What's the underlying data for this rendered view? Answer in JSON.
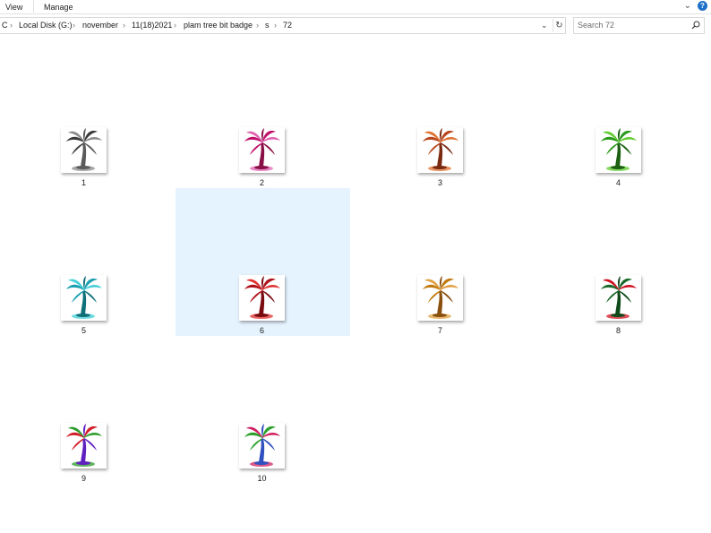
{
  "ribbon": {
    "tabs": [
      "View",
      "Manage"
    ]
  },
  "address": {
    "crumbs": [
      "C",
      "Local Disk (G:)",
      "november",
      "11(18)2021",
      "plam tree bit badge",
      "s",
      "72"
    ]
  },
  "search": {
    "placeholder": "Search 72"
  },
  "files": [
    {
      "name": "1",
      "palette": [
        "#3a3a3a",
        "#8a8a8a",
        "#5a5a5a"
      ]
    },
    {
      "name": "2",
      "palette": [
        "#c0106a",
        "#e060b0",
        "#8a1048"
      ]
    },
    {
      "name": "3",
      "palette": [
        "#b8441a",
        "#e07030",
        "#7a2a10"
      ]
    },
    {
      "name": "4",
      "palette": [
        "#2a9a1a",
        "#60cc30",
        "#1a6010"
      ]
    },
    {
      "name": "5",
      "palette": [
        "#1aa0b0",
        "#40d0d8",
        "#10707a"
      ]
    },
    {
      "name": "6",
      "palette": [
        "#b0101a",
        "#e03030",
        "#7a0a10"
      ]
    },
    {
      "name": "7",
      "palette": [
        "#c07a10",
        "#e0a040",
        "#8a5010"
      ]
    },
    {
      "name": "8",
      "palette": [
        "#1a6a2a",
        "#d01020",
        "#104a1a"
      ]
    },
    {
      "name": "9",
      "palette": [
        "#d0202a",
        "#2a9a2a",
        "#6020c0"
      ]
    },
    {
      "name": "10",
      "palette": [
        "#2aa02a",
        "#d02060",
        "#3050c0"
      ]
    }
  ],
  "selected_file": "6"
}
